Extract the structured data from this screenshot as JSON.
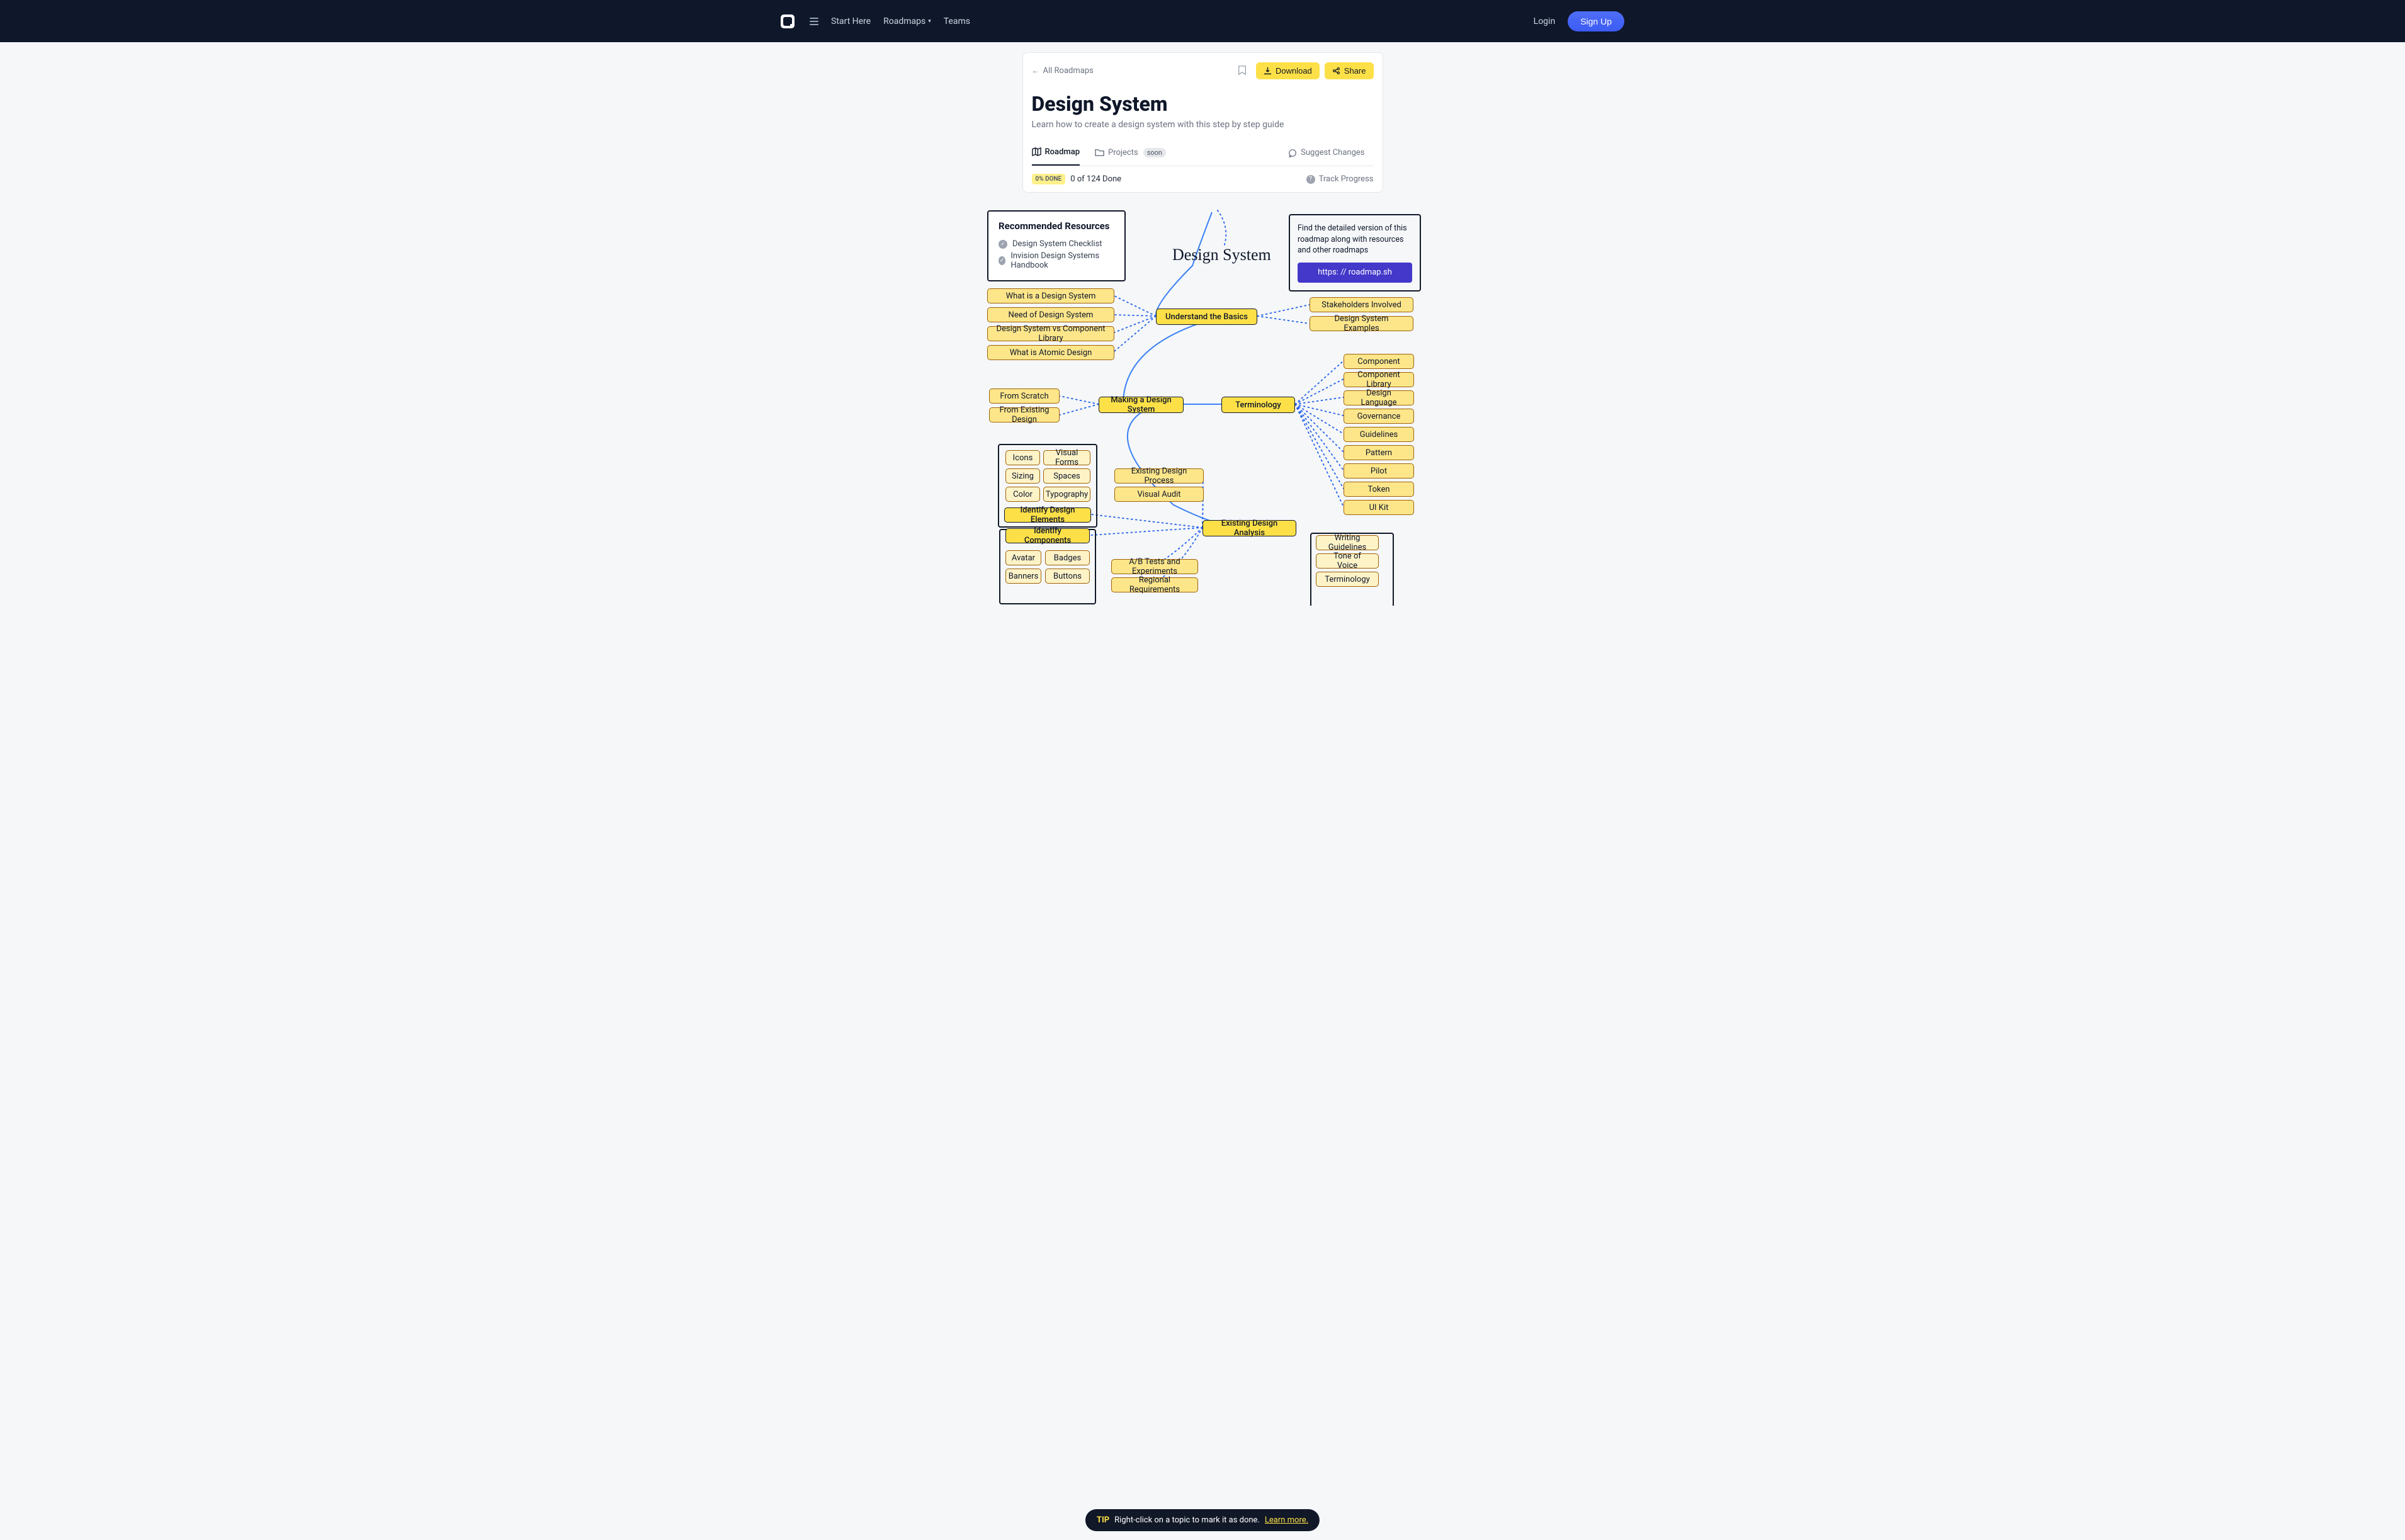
{
  "header": {
    "nav": {
      "start": "Start Here",
      "roadmaps": "Roadmaps",
      "teams": "Teams"
    },
    "login": "Login",
    "signup": "Sign Up"
  },
  "card": {
    "back": "All Roadmaps",
    "download": "Download",
    "share": "Share",
    "title": "Design System",
    "subtitle": "Learn how to create a design system with this step by step guide",
    "tab_roadmap": "Roadmap",
    "tab_projects": "Projects",
    "soon": "soon",
    "suggest": "Suggest Changes",
    "done_badge": "0% DONE",
    "done_text": "0 of 124 Done",
    "track": "Track Progress"
  },
  "resources": {
    "title": "Recommended Resources",
    "items": [
      "Design System Checklist",
      "Invision Design Systems Handbook"
    ]
  },
  "right_box": {
    "text": "Find the detailed version of this roadmap along with resources and other roadmaps",
    "link": "https: // roadmap.sh"
  },
  "diagram": {
    "title": "Design System",
    "understand": "Understand the Basics",
    "basics_left": [
      "What is a Design System",
      "Need of Design System",
      "Design System vs Component Library",
      "What is Atomic Design"
    ],
    "basics_right": [
      "Stakeholders Involved",
      "Design System Examples"
    ],
    "making": "Making a Design System",
    "making_left": [
      "From Scratch",
      "From Existing Design"
    ],
    "terminology": "Terminology",
    "terminology_items": [
      "Component",
      "Component Library",
      "Design Language",
      "Governance",
      "Guidelines",
      "Pattern",
      "Pilot",
      "Token",
      "UI Kit"
    ],
    "analysis": "Existing Design Analysis",
    "analysis_left": [
      "Existing Design Process",
      "Visual Audit"
    ],
    "elements_main": "Identify Design Elements",
    "elements_items": [
      "Icons",
      "Visual Forms",
      "Sizing",
      "Spaces",
      "Color",
      "Typography"
    ],
    "components_main": "Identify Components",
    "components_items": [
      "Avatar",
      "Badges",
      "Banners",
      "Buttons"
    ],
    "ab": "A/B Tests and Experiments",
    "regional": "Regional Requirements",
    "right_bottom": [
      "Writing Guidelines",
      "Tone of Voice",
      "Terminology"
    ]
  },
  "tip": {
    "label": "TIP",
    "text": "Right-click on a topic to mark it as done.",
    "link": "Learn more."
  }
}
